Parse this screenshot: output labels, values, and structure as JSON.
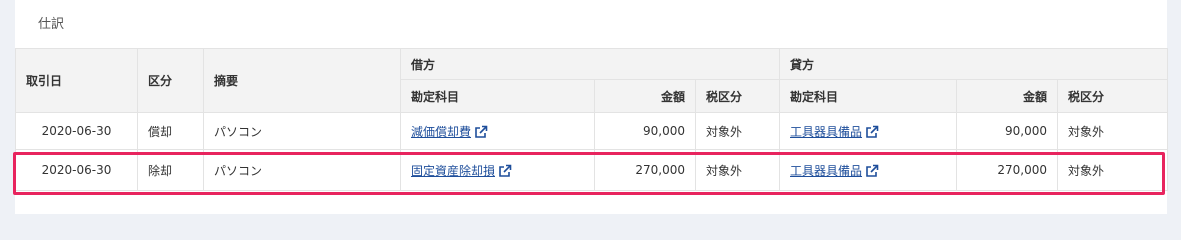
{
  "panel": {
    "title": "仕訳"
  },
  "headers": {
    "date": "取引日",
    "category": "区分",
    "summary": "摘要",
    "debit": "借方",
    "credit": "貸方",
    "account": "勘定科目",
    "amount": "金額",
    "tax": "税区分"
  },
  "rows": [
    {
      "date": "2020-06-30",
      "category": "償却",
      "summary": "パソコン",
      "debit_account": "減価償却費",
      "debit_amount": "90,000",
      "debit_tax": "対象外",
      "credit_account": "工具器具備品",
      "credit_amount": "90,000",
      "credit_tax": "対象外"
    },
    {
      "date": "2020-06-30",
      "category": "除却",
      "summary": "パソコン",
      "debit_account": "固定資産除却損",
      "debit_amount": "270,000",
      "debit_tax": "対象外",
      "credit_account": "工具器具備品",
      "credit_amount": "270,000",
      "credit_tax": "対象外"
    }
  ],
  "icons": {
    "external_link": "external-link-icon"
  },
  "colors": {
    "highlight": "#e8245e",
    "link": "#1e4e9b"
  }
}
